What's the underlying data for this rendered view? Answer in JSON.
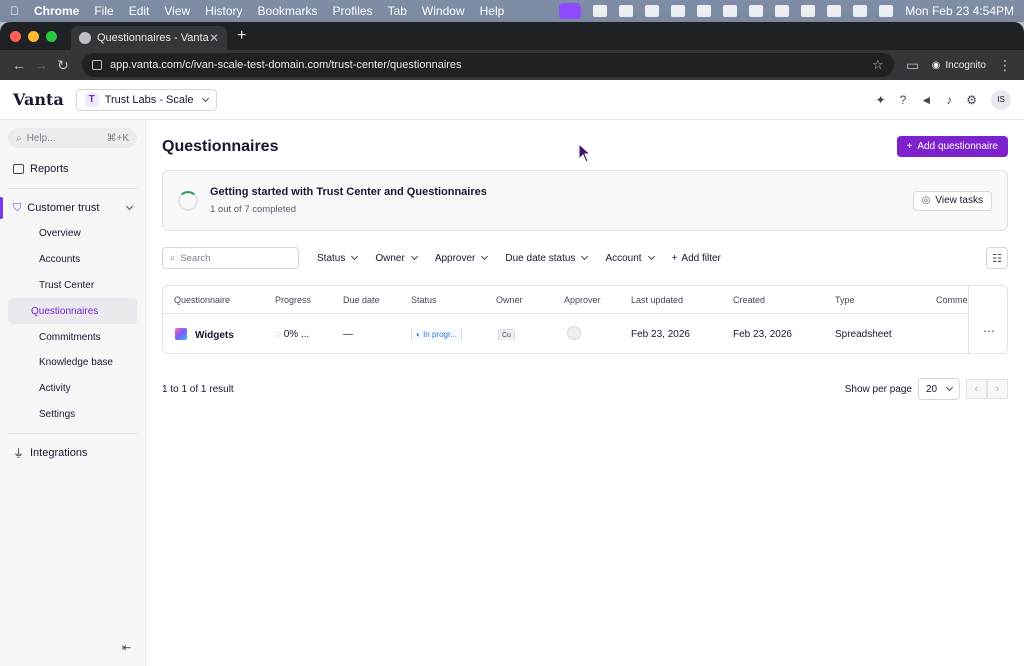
{
  "menubar": {
    "app": "Chrome",
    "items": [
      "File",
      "Edit",
      "View",
      "History",
      "Bookmarks",
      "Profiles",
      "Tab",
      "Window",
      "Help"
    ],
    "clock": "Mon Feb 23  4:54PM"
  },
  "browser": {
    "tab_title": "Questionnaires - Vanta",
    "url": "app.vanta.com/c/ivan-scale-test-domain.com/trust-center/questionnaires",
    "incognito_label": "Incognito"
  },
  "header": {
    "logo": "Vanta",
    "org_badge": "T",
    "org_name": "Trust Labs - Scale",
    "avatar_initials": "IS"
  },
  "sidebar": {
    "help_placeholder": "Help...",
    "help_shortcut": "⌘+K",
    "reports": "Reports",
    "group_label": "Customer trust",
    "sub_items": [
      "Overview",
      "Accounts",
      "Trust Center",
      "Questionnaires",
      "Commitments",
      "Knowledge base",
      "Activity",
      "Settings"
    ],
    "integrations": "Integrations",
    "collapse_glyph": "⇤"
  },
  "main": {
    "title": "Questionnaires",
    "add_button": "Add questionnaire",
    "banner": {
      "title": "Getting started with Trust Center and Questionnaires",
      "progress": "1 out of 7 completed",
      "completed": 1,
      "total": 7,
      "button": "View tasks"
    },
    "search_placeholder": "Search",
    "filters": [
      "Status",
      "Owner",
      "Approver",
      "Due date status",
      "Account"
    ],
    "add_filter": "Add filter",
    "table": {
      "columns": [
        "Questionnaire",
        "Progress",
        "Due date",
        "Status",
        "Owner",
        "Approver",
        "Last updated",
        "Created",
        "Type",
        "Comme..."
      ],
      "rows": [
        {
          "name": "Widgets",
          "progress": "0% ...",
          "due_date": "—",
          "status": "In progr...",
          "owner": "Cu",
          "last_updated": "Feb 23, 2026",
          "created": "Feb 23, 2026",
          "type": "Spreadsheet",
          "menu": "⋯"
        }
      ]
    },
    "footer": {
      "result_text": "1 to 1 of 1 result",
      "per_page_label": "Show per page",
      "per_page_value": "20"
    }
  },
  "colors": {
    "accent": "#7e22ce",
    "active_nav": "#6d28d9",
    "status_blue": "#3b7bd6",
    "progress_green": "#2e9b4a"
  }
}
